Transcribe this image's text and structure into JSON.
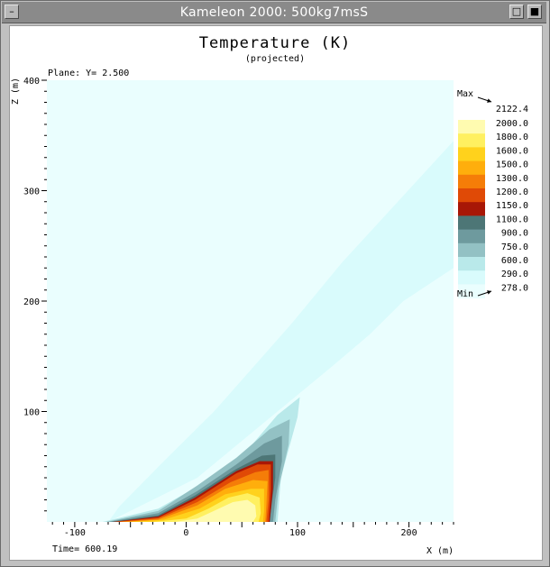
{
  "window": {
    "title": "Kameleon 2000: 500kg7msS",
    "menu_glyph": "–",
    "button_restore": "□",
    "button_close": "■"
  },
  "plot": {
    "title": "Temperature (K)",
    "subtitle": "(projected)",
    "plane_label": "Plane: Y= 2.500",
    "time_label": "Time=  600.19",
    "xlabel": "X (m)",
    "zlabel": "Z (m)"
  },
  "legend": {
    "max_label": "Max",
    "max_value": "2122.4",
    "min_label": "Min",
    "min_value": "278.0",
    "levels": [
      {
        "value": "2000.0",
        "color": "#fffbb0"
      },
      {
        "value": "1800.0",
        "color": "#fff060"
      },
      {
        "value": "1600.0",
        "color": "#ffd21c"
      },
      {
        "value": "1500.0",
        "color": "#ffae0c"
      },
      {
        "value": "1300.0",
        "color": "#f57d08"
      },
      {
        "value": "1200.0",
        "color": "#e04a06"
      },
      {
        "value": "1150.0",
        "color": "#a81706"
      },
      {
        "value": "1100.0",
        "color": "#4d7676"
      },
      {
        "value": "900.0",
        "color": "#6e9a9e"
      },
      {
        "value": "750.0",
        "color": "#93c1c4"
      },
      {
        "value": "600.0",
        "color": "#b9e9ea"
      },
      {
        "value": "290.0",
        "color": "#d9fbfc"
      },
      {
        "value": "278.0",
        "color": "#eafefe"
      }
    ]
  },
  "chart_data": {
    "type": "heatmap",
    "title": "Temperature (K)",
    "subtitle": "(projected)",
    "xlabel": "X (m)",
    "ylabel": "Z (m)",
    "xlim": [
      -125,
      240
    ],
    "ylim": [
      0,
      400
    ],
    "x_ticks": [
      -100,
      0,
      100,
      200
    ],
    "y_ticks": [
      100,
      200,
      300,
      400
    ],
    "colorbar": {
      "max": 2122.4,
      "min": 278.0,
      "levels": [
        2000.0,
        1800.0,
        1600.0,
        1500.0,
        1300.0,
        1200.0,
        1150.0,
        1100.0,
        900.0,
        750.0,
        600.0,
        290.0,
        278.0
      ]
    },
    "regions": [
      {
        "level": 290.0,
        "points": [
          [
            -70,
            0
          ],
          [
            10,
            40
          ],
          [
            130,
            140
          ],
          [
            165,
            170
          ],
          [
            195,
            200
          ],
          [
            240,
            230
          ],
          [
            240,
            345
          ],
          [
            190,
            290
          ],
          [
            140,
            235
          ],
          [
            95,
            180
          ],
          [
            60,
            140
          ],
          [
            25,
            100
          ],
          [
            -20,
            55
          ],
          [
            -60,
            14
          ]
        ]
      },
      {
        "level": 600.0,
        "points": [
          [
            -75,
            0
          ],
          [
            -25,
            12
          ],
          [
            15,
            35
          ],
          [
            55,
            65
          ],
          [
            82,
            97
          ],
          [
            102,
            113
          ],
          [
            100,
            95
          ],
          [
            85,
            40
          ],
          [
            82,
            0
          ]
        ]
      },
      {
        "level": 750.0,
        "points": [
          [
            -72,
            0
          ],
          [
            -25,
            10
          ],
          [
            10,
            33
          ],
          [
            45,
            58
          ],
          [
            75,
            84
          ],
          [
            93,
            93
          ],
          [
            92,
            70
          ],
          [
            83,
            30
          ],
          [
            80,
            0
          ]
        ]
      },
      {
        "level": 900.0,
        "points": [
          [
            -70,
            0
          ],
          [
            -25,
            8
          ],
          [
            10,
            28
          ],
          [
            45,
            52
          ],
          [
            70,
            71
          ],
          [
            86,
            78
          ],
          [
            86,
            55
          ],
          [
            80,
            20
          ],
          [
            78,
            0
          ]
        ]
      },
      {
        "level": 1100.0,
        "points": [
          [
            -68,
            0
          ],
          [
            -25,
            6
          ],
          [
            8,
            24
          ],
          [
            45,
            48
          ],
          [
            68,
            60
          ],
          [
            80,
            61
          ],
          [
            80,
            40
          ],
          [
            76,
            10
          ],
          [
            75,
            0
          ]
        ]
      },
      {
        "level": 1150.0,
        "points": [
          [
            -66,
            0
          ],
          [
            -25,
            5
          ],
          [
            8,
            22
          ],
          [
            45,
            46
          ],
          [
            66,
            55
          ],
          [
            78,
            55
          ],
          [
            78,
            30
          ],
          [
            75,
            0
          ]
        ]
      },
      {
        "level": 1200.0,
        "points": [
          [
            -64,
            0
          ],
          [
            -25,
            4
          ],
          [
            8,
            20
          ],
          [
            45,
            44
          ],
          [
            64,
            52
          ],
          [
            76,
            52
          ],
          [
            76,
            30
          ],
          [
            74,
            0
          ]
        ]
      },
      {
        "level": 1300.0,
        "points": [
          [
            -62,
            0
          ],
          [
            -25,
            3
          ],
          [
            10,
            18
          ],
          [
            40,
            36
          ],
          [
            62,
            45
          ],
          [
            74,
            47
          ],
          [
            74,
            20
          ],
          [
            72,
            0
          ]
        ]
      },
      {
        "level": 1500.0,
        "points": [
          [
            -58,
            0
          ],
          [
            -25,
            2
          ],
          [
            10,
            15
          ],
          [
            35,
            30
          ],
          [
            60,
            38
          ],
          [
            73,
            37
          ],
          [
            72,
            15
          ],
          [
            71,
            0
          ]
        ]
      },
      {
        "level": 1600.0,
        "points": [
          [
            -50,
            0
          ],
          [
            -20,
            2
          ],
          [
            12,
            12
          ],
          [
            35,
            25
          ],
          [
            58,
            30
          ],
          [
            70,
            30
          ],
          [
            70,
            10
          ],
          [
            69,
            0
          ]
        ]
      },
      {
        "level": 1800.0,
        "points": [
          [
            -30,
            0
          ],
          [
            0,
            3
          ],
          [
            20,
            12
          ],
          [
            38,
            22
          ],
          [
            55,
            26
          ],
          [
            66,
            22
          ],
          [
            67,
            8
          ],
          [
            65,
            0
          ]
        ]
      },
      {
        "level": 2000.0,
        "points": [
          [
            -10,
            0
          ],
          [
            10,
            3
          ],
          [
            25,
            10
          ],
          [
            42,
            18
          ],
          [
            55,
            20
          ],
          [
            62,
            15
          ],
          [
            63,
            5
          ],
          [
            60,
            0
          ]
        ]
      }
    ]
  }
}
